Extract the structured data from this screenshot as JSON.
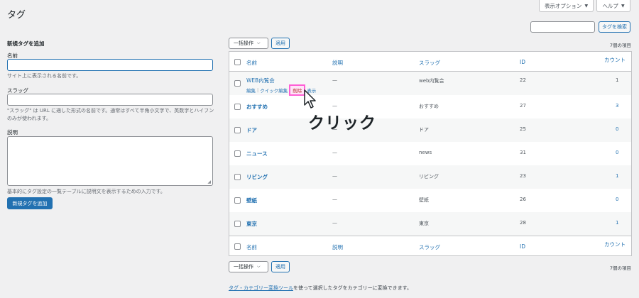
{
  "header": {
    "title": "タグ",
    "screen_options": "表示オプション",
    "help": "ヘルプ"
  },
  "search": {
    "value": "",
    "button": "タグを検索"
  },
  "add_form": {
    "heading": "新規タグを追加",
    "name_label": "名前",
    "name_desc": "サイト上に表示される名前です。",
    "slug_label": "スラッグ",
    "slug_desc": "\"スラッグ\" は URL に適した形式の名前です。通常はすべて半角小文字で、英数字とハイフンのみが使われます。",
    "desc_label": "説明",
    "desc_desc": "基本的にタグ設定の一覧テーブルに説明文を表示するための入力です。",
    "submit": "新規タグを追加"
  },
  "bulk": {
    "select": "一括操作",
    "apply": "適用",
    "count": "7個の項目"
  },
  "table": {
    "headers": {
      "name": "名前",
      "description": "説明",
      "slug": "スラッグ",
      "id": "ID",
      "count": "カウント"
    },
    "rows": [
      {
        "name": "WEB内覧会",
        "description": "—",
        "slug": "web内覧会",
        "id": "22",
        "count": "1"
      },
      {
        "name": "おすすめ",
        "description": "—",
        "slug": "おすすめ",
        "id": "27",
        "count": "3"
      },
      {
        "name": "ドア",
        "description": "—",
        "slug": "ドア",
        "id": "25",
        "count": "0"
      },
      {
        "name": "ニュース",
        "description": "—",
        "slug": "news",
        "id": "31",
        "count": "0"
      },
      {
        "name": "リビング",
        "description": "—",
        "slug": "リビング",
        "id": "23",
        "count": "1"
      },
      {
        "name": "壁紙",
        "description": "—",
        "slug": "壁紙",
        "id": "26",
        "count": "0"
      },
      {
        "name": "東京",
        "description": "—",
        "slug": "東京",
        "id": "28",
        "count": "1"
      }
    ],
    "row_actions": {
      "edit": "編集",
      "quick_edit": "クイック編集",
      "delete": "削除",
      "view": "表示"
    }
  },
  "annotation": {
    "text": "クリック",
    "highlight_color": "#ff5fd6"
  },
  "footer": {
    "link": "タグ・カテゴリー変換ツール",
    "text": "を使って選択したタグをカテゴリーに変換できます。"
  }
}
